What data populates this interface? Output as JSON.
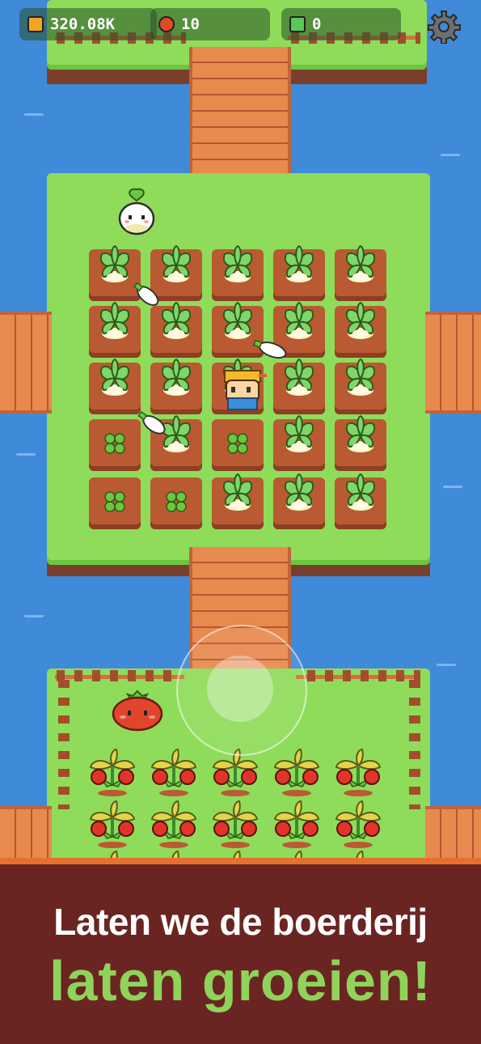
{
  "hud": {
    "coins": "320.08K",
    "seeds": "10",
    "gems": "0",
    "coin_color": "#f2a51e",
    "seed_color": "#e24a2a",
    "gem_color": "#59c95a"
  },
  "icons": {
    "settings": "gear-icon",
    "coin": "coin-icon",
    "seed": "tomato-seed-icon",
    "gem": "gem-icon"
  },
  "banner": {
    "line1": "Laten we de boerderij",
    "line2": "laten groeien!",
    "line1_color": "#ffffff",
    "line2_color": "#8fd35a",
    "background": "#6a2523"
  }
}
